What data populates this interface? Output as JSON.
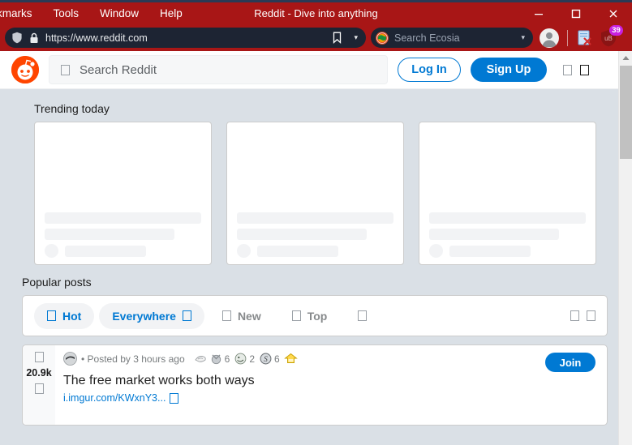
{
  "browser": {
    "menu": [
      {
        "label": "kmarks",
        "name": "menu-bookmarks"
      },
      {
        "label": "Tools",
        "name": "menu-tools"
      },
      {
        "label": "Window",
        "name": "menu-window"
      },
      {
        "label": "Help",
        "name": "menu-help"
      }
    ],
    "window_title": "Reddit - Dive into anything",
    "titlebar_color": "#a81616",
    "controls": {
      "minimize": "–",
      "maximize": "☐",
      "close": "✕"
    },
    "url": "https://www.reddit.com",
    "url_caret": "▾",
    "search_placeholder": "Search Ecosia",
    "search_caret": "▾",
    "extension_badge": "39"
  },
  "reddit": {
    "search_placeholder": "Search Reddit",
    "login_label": "Log In",
    "signup_label": "Sign Up",
    "trending_title": "Trending today",
    "popular_title": "Popular posts",
    "trending_cards": [
      {
        "name": "trending-card-1"
      },
      {
        "name": "trending-card-2"
      },
      {
        "name": "trending-card-3"
      }
    ],
    "sort": {
      "hot": "Hot",
      "filter": "Everywhere",
      "new": "New",
      "top": "Top"
    },
    "post": {
      "score": "20.9k",
      "posted_by": "• Posted by 3 hours ago",
      "awards": [
        {
          "name": "award-silver-wing",
          "count": ""
        },
        {
          "name": "award-grey-medal",
          "count": "6"
        },
        {
          "name": "award-green-face",
          "count": "2"
        },
        {
          "name": "award-silver-s",
          "count": "6"
        },
        {
          "name": "award-gold-house",
          "count": ""
        }
      ],
      "title": "The free market works both ways",
      "link": "i.imgur.com/KWxnY3...",
      "join_label": "Join"
    }
  },
  "colors": {
    "reddit_orange": "#ff4500",
    "reddit_blue": "#0079d3",
    "page_bg": "#dae0e6",
    "chrome_red": "#a81616",
    "urlbar_dark": "#1d2433",
    "badge_magenta": "#c820e0"
  }
}
